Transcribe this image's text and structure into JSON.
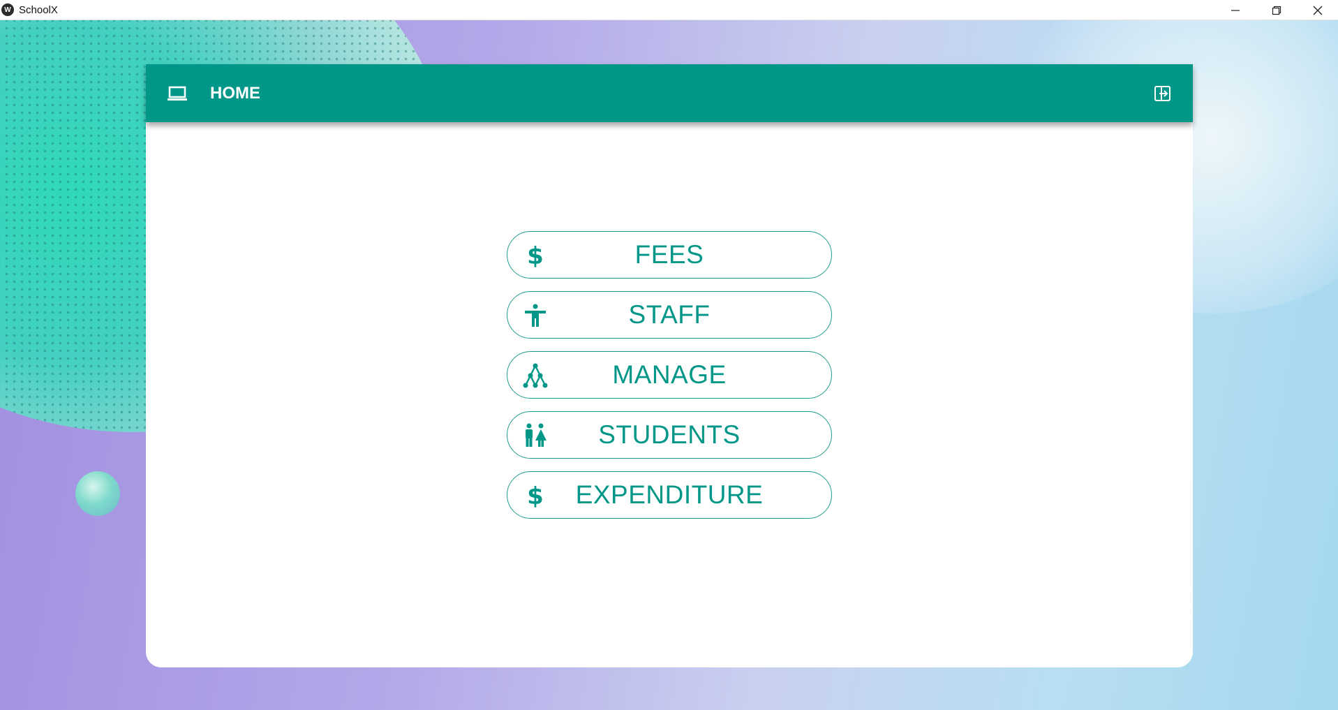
{
  "window": {
    "title": "SchoolX",
    "app_icon_glyph": "W"
  },
  "app_bar": {
    "title": "HOME",
    "leading_icon": "laptop-icon",
    "trailing_icon": "logout-icon",
    "color": "#009688"
  },
  "menu": {
    "items": [
      {
        "label": "FEES",
        "icon": "dollar-icon"
      },
      {
        "label": "STAFF",
        "icon": "person-icon"
      },
      {
        "label": "MANAGE",
        "icon": "hierarchy-icon"
      },
      {
        "label": "STUDENTS",
        "icon": "man-woman-icon"
      },
      {
        "label": "EXPENDITURE",
        "icon": "dollar-icon"
      }
    ],
    "accent_color": "#009688"
  }
}
